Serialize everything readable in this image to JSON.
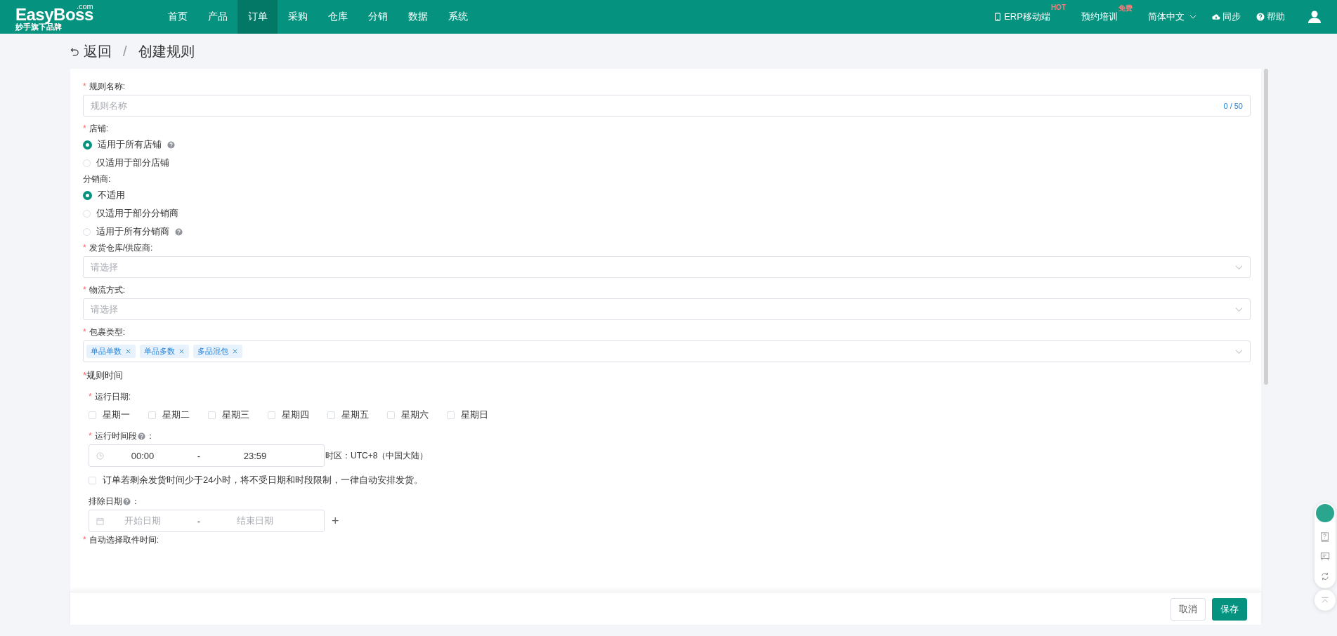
{
  "header": {
    "logo": {
      "name": "EasyBoss",
      "domain": ".com",
      "tagline": "妙手旗下品牌"
    },
    "menu": [
      {
        "label": "首页",
        "selected": false
      },
      {
        "label": "产品",
        "selected": false
      },
      {
        "label": "订单",
        "selected": true
      },
      {
        "label": "采购",
        "selected": false
      },
      {
        "label": "仓库",
        "selected": false
      },
      {
        "label": "分销",
        "selected": false
      },
      {
        "label": "数据",
        "selected": false
      },
      {
        "label": "系统",
        "selected": false
      }
    ],
    "tools": [
      {
        "kind": "mobile",
        "label": "ERP移动端",
        "badge": "HOT"
      },
      {
        "kind": "plain",
        "label": "预约培训",
        "badge": "免费"
      },
      {
        "kind": "dropdown",
        "label": "简体中文"
      },
      {
        "kind": "cloud",
        "label": "同步"
      },
      {
        "kind": "help",
        "label": "帮助"
      }
    ]
  },
  "breadcrumb": {
    "back": "返回",
    "separator": "/",
    "current": "创建规则"
  },
  "form": {
    "name": {
      "label": "规则名称:",
      "mark": "*",
      "placeholder": "规则名称",
      "counter": "0 / 50"
    },
    "shop": {
      "label": "店铺:",
      "mark": "*",
      "options": [
        {
          "label": "适用于所有店铺",
          "selected": true,
          "help": true
        },
        {
          "label": "仅适用于部分店铺",
          "selected": false,
          "help": false
        }
      ]
    },
    "distributor": {
      "label": "分销商:",
      "options": [
        {
          "label": "不适用",
          "selected": true,
          "help": false
        },
        {
          "label": "仅适用于部分分销商",
          "selected": false,
          "help": false
        },
        {
          "label": "适用于所有分销商",
          "selected": false,
          "help": true
        }
      ]
    },
    "selects": [
      {
        "label": "发货仓库/供应商:",
        "mark": "*",
        "placeholder": "请选择"
      },
      {
        "label": "物流方式:",
        "mark": "*",
        "placeholder": "请选择"
      }
    ],
    "package": {
      "label": "包裹类型:",
      "mark": "*",
      "tags": [
        "单品单数",
        "单品多数",
        "多品混包"
      ]
    },
    "schedule": {
      "title": "规则时间",
      "mark": "*",
      "days": {
        "label": "运行日期:",
        "mark": "*",
        "items": [
          {
            "label": "星期一",
            "checked": false
          },
          {
            "label": "星期二",
            "checked": false
          },
          {
            "label": "星期三",
            "checked": false
          },
          {
            "label": "星期四",
            "checked": false
          },
          {
            "label": "星期五",
            "checked": false
          },
          {
            "label": "星期六",
            "checked": false
          },
          {
            "label": "星期日",
            "checked": false
          }
        ]
      },
      "period": {
        "label": "运行时间段",
        "mark": "*",
        "colon": "：",
        "start": "00:00",
        "dash": "-",
        "end": "23:59",
        "timezone": "时区：UTC+8（中国大陆）"
      },
      "override": {
        "label": "订单若剩余发货时间少于24小时，将不受日期和时段限制，一律自动安排发货。",
        "checked": false
      },
      "exclude": {
        "label": "排除日期",
        "colon": "：",
        "start_placeholder": "开始日期",
        "dash": "-",
        "end_placeholder": "结束日期",
        "add": "+"
      }
    },
    "pickup": {
      "label": "自动选择取件时间:",
      "mark": "*"
    }
  },
  "footer": {
    "buttons": [
      {
        "label": "取消",
        "kind": "default"
      },
      {
        "label": "保存",
        "kind": "primary"
      }
    ]
  }
}
